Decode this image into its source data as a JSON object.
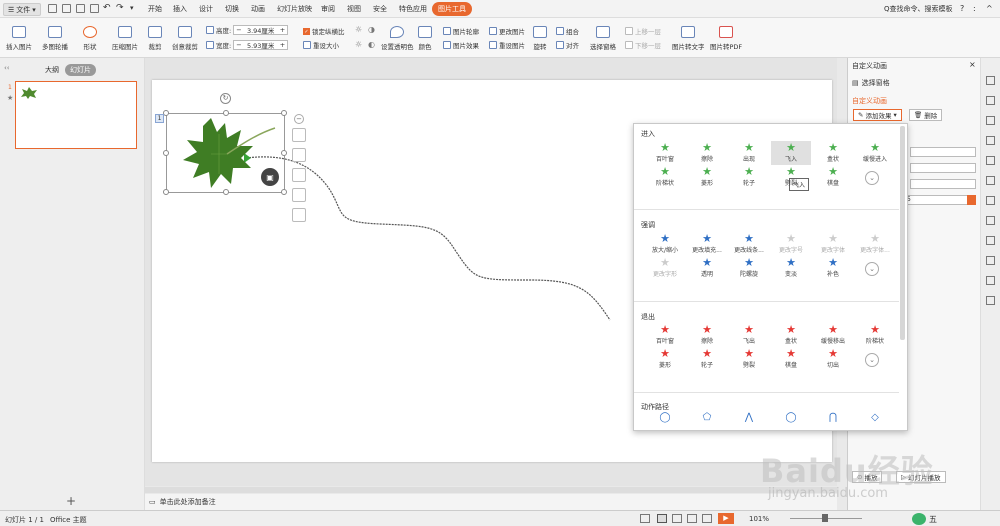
{
  "menubar": {
    "file_label": "文件",
    "tabs": [
      "开始",
      "插入",
      "设计",
      "切换",
      "动画",
      "幻灯片放映",
      "审阅",
      "视图",
      "安全",
      "特色应用"
    ],
    "active_tab": "图片工具",
    "search": "Q查找命令、搜索模板",
    "help_icons": [
      "?",
      ":",
      "^"
    ]
  },
  "ribbon": {
    "insert_pic": "插入图片",
    "multi_pic": "多图轮播",
    "shape": "形状",
    "compress": "压缩图片",
    "crop": "裁剪",
    "creative_crop": "创意裁剪",
    "height_label": "高度:",
    "height_value": "3.94厘米",
    "width_label": "宽度:",
    "width_value": "5.93厘米",
    "lock_ratio": "锁定纵横比",
    "reset_size": "重设大小",
    "set_transparent": "设置透明色",
    "color": "颜色",
    "pic_outline": "图片轮廓",
    "pic_effect": "图片效果",
    "change_pic": "更改图片",
    "reset_pic": "重设图片",
    "combine": "组合",
    "align": "对齐",
    "rotate": "旋转",
    "select_pane": "选择窗格",
    "up_one": "上移一层",
    "down_one": "下移一层",
    "pic_to_text": "图片转文字",
    "pic_to_pdf": "图片转PDF"
  },
  "left_panel": {
    "tab_outline": "大纲",
    "tab_slides": "幻灯片",
    "slide_number": "1"
  },
  "slide": {
    "anim_tag": "1"
  },
  "notes": {
    "placeholder": "单击此处添加备注"
  },
  "right_panel": {
    "title": "自定义动画",
    "select_pane": "选择窗格",
    "section": "自定义动画",
    "add_effect": "添加效果",
    "delete": "删除",
    "speed_value": "5",
    "play": "播放",
    "slideshow": "幻灯片播放"
  },
  "dropdown": {
    "entrance_title": "进入",
    "entrance_items": [
      "百叶窗",
      "擦除",
      "出现",
      "飞入",
      "盒状",
      "缓慢进入",
      "阶梯状",
      "菱形",
      "轮子",
      "劈裂",
      "棋盘"
    ],
    "tooltip": "飞入",
    "emphasis_title": "强调",
    "emphasis_items": [
      "放大/缩小",
      "更改填充...",
      "更改线条...",
      "更改字号",
      "更改字体",
      "更改字体...",
      "更改字形",
      "透明",
      "陀螺旋",
      "变淡",
      "补色"
    ],
    "exit_title": "退出",
    "exit_items": [
      "百叶窗",
      "擦除",
      "飞出",
      "盒状",
      "缓慢移出",
      "阶梯状",
      "菱形",
      "轮子",
      "劈裂",
      "棋盘",
      "切出"
    ],
    "motion_title": "动作路径",
    "more_glyph": "⌄",
    "colors": {
      "entrance": "#4caf50",
      "emphasis": "#2f6fc4",
      "exit": "#e53935",
      "accent": "#e8682e"
    }
  },
  "statusbar": {
    "slide_info": "幻灯片 1 / 1",
    "theme": "Office 主题",
    "zoom": "101%",
    "ime": "五"
  },
  "watermark": {
    "line1": "Baidu经验",
    "line2": "jingyan.baidu.com"
  }
}
